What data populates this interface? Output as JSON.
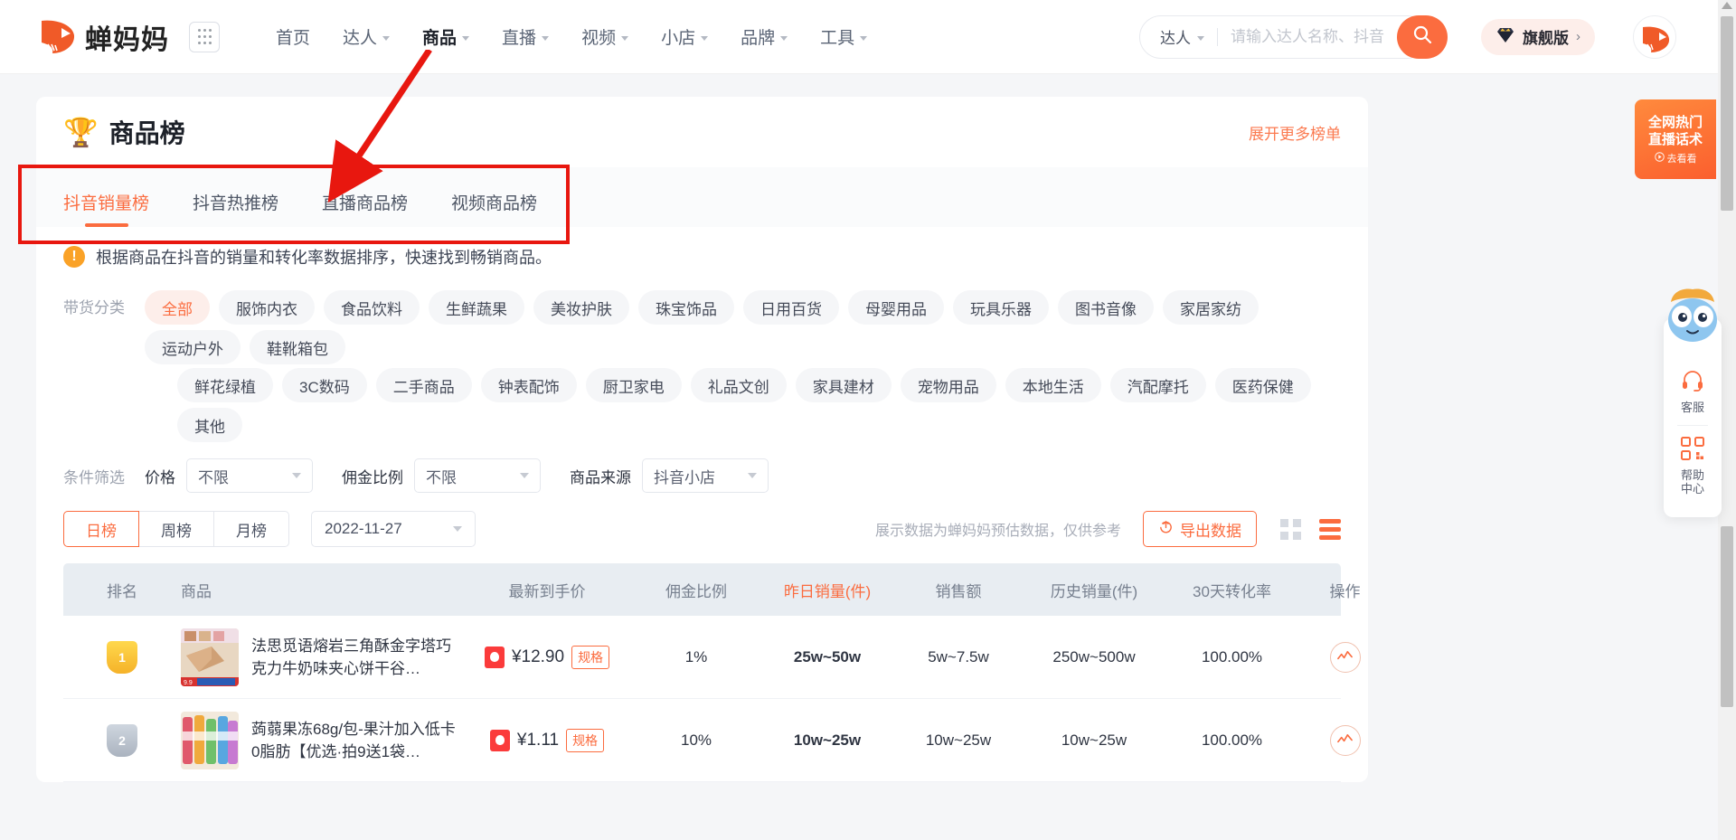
{
  "header": {
    "brand": "蝉妈妈",
    "apps_icon": "grid-apps-icon",
    "nav": [
      {
        "label": "首页",
        "has_caret": false,
        "active": false
      },
      {
        "label": "达人",
        "has_caret": true,
        "active": false
      },
      {
        "label": "商品",
        "has_caret": true,
        "active": true
      },
      {
        "label": "直播",
        "has_caret": true,
        "active": false
      },
      {
        "label": "视频",
        "has_caret": true,
        "active": false
      },
      {
        "label": "小店",
        "has_caret": true,
        "active": false
      },
      {
        "label": "品牌",
        "has_caret": true,
        "active": false
      },
      {
        "label": "工具",
        "has_caret": true,
        "active": false
      }
    ],
    "search": {
      "type_label": "达人",
      "placeholder": "请输入达人名称、抖音号",
      "value": "",
      "button_icon": "search-icon",
      "accent": "#fb6c3f"
    },
    "vip": {
      "label": "旗舰版",
      "arrow": "›",
      "icon": "diamond-crown-icon"
    },
    "avatar_icon": "user-avatar-logo"
  },
  "promo": {
    "line1": "全网热门",
    "line2": "直播话术",
    "cta": "去看看",
    "cta_icon": "play-circle-icon"
  },
  "page": {
    "title": "商品榜",
    "title_icon": "trophy-icon",
    "expand_more": "展开更多榜单",
    "tabs": [
      {
        "label": "抖音销量榜",
        "active": true
      },
      {
        "label": "抖音热推榜",
        "active": false
      },
      {
        "label": "直播商品榜",
        "active": false
      },
      {
        "label": "视频商品榜",
        "active": false
      }
    ],
    "info_text": "根据商品在抖音的销量和转化率数据排序，快速找到畅销商品。",
    "info_icon": "exclamation-circle-icon"
  },
  "category_filter": {
    "label": "带货分类",
    "row1": [
      {
        "label": "全部",
        "active": true
      },
      {
        "label": "服饰内衣",
        "active": false
      },
      {
        "label": "食品饮料",
        "active": false
      },
      {
        "label": "生鲜蔬果",
        "active": false
      },
      {
        "label": "美妆护肤",
        "active": false
      },
      {
        "label": "珠宝饰品",
        "active": false
      },
      {
        "label": "日用百货",
        "active": false
      },
      {
        "label": "母婴用品",
        "active": false
      },
      {
        "label": "玩具乐器",
        "active": false
      },
      {
        "label": "图书音像",
        "active": false
      },
      {
        "label": "家居家纺",
        "active": false
      },
      {
        "label": "运动户外",
        "active": false
      },
      {
        "label": "鞋靴箱包",
        "active": false
      }
    ],
    "row2": [
      {
        "label": "鲜花绿植",
        "active": false
      },
      {
        "label": "3C数码",
        "active": false
      },
      {
        "label": "二手商品",
        "active": false
      },
      {
        "label": "钟表配饰",
        "active": false
      },
      {
        "label": "厨卫家电",
        "active": false
      },
      {
        "label": "礼品文创",
        "active": false
      },
      {
        "label": "家具建材",
        "active": false
      },
      {
        "label": "宠物用品",
        "active": false
      },
      {
        "label": "本地生活",
        "active": false
      },
      {
        "label": "汽配摩托",
        "active": false
      },
      {
        "label": "医药保健",
        "active": false
      },
      {
        "label": "其他",
        "active": false
      }
    ]
  },
  "condition_filter": {
    "label": "条件筛选",
    "price": {
      "label": "价格",
      "value": "不限"
    },
    "commission": {
      "label": "佣金比例",
      "value": "不限"
    },
    "source": {
      "label": "商品来源",
      "value": "抖音小店"
    }
  },
  "period": {
    "segments": [
      {
        "label": "日榜",
        "active": true
      },
      {
        "label": "周榜",
        "active": false
      },
      {
        "label": "月榜",
        "active": false
      }
    ],
    "date": "2022-11-27",
    "note": "展示数据为蝉妈妈预估数据，仅供参考",
    "export_label": "导出数据",
    "export_icon": "upload-icon",
    "view_grid_icon": "grid-view-icon",
    "view_list_icon": "list-view-icon"
  },
  "table": {
    "columns": [
      {
        "label": "排名",
        "highlight": false
      },
      {
        "label": "商品",
        "highlight": false
      },
      {
        "label": "最新到手价",
        "highlight": false
      },
      {
        "label": "佣金比例",
        "highlight": false
      },
      {
        "label": "昨日销量(件)",
        "highlight": true
      },
      {
        "label": "销售额",
        "highlight": false
      },
      {
        "label": "历史销量(件)",
        "highlight": false
      },
      {
        "label": "30天转化率",
        "highlight": false
      },
      {
        "label": "操作",
        "highlight": false
      }
    ],
    "rows": [
      {
        "rank": "1",
        "name": "法思觅语熔岩三角酥金字塔巧克力牛奶味夹心饼干谷…",
        "price": "¥12.90",
        "spec": "规格",
        "commission": "1%",
        "sales_yesterday": "25w~50w",
        "amount": "5w~7.5w",
        "history": "250w~500w",
        "conversion": "100.00%",
        "action_icon": "trend-chart-icon"
      },
      {
        "rank": "2",
        "name": "蒟蒻果冻68g/包-果汁加入低卡0脂肪【优选·拍9送1袋…",
        "price": "¥1.11",
        "spec": "规格",
        "commission": "10%",
        "sales_yesterday": "10w~25w",
        "amount": "10w~25w",
        "history": "10w~25w",
        "conversion": "100.00%",
        "action_icon": "trend-chart-icon"
      }
    ]
  },
  "right_rail": {
    "mascot_icon": "mascot-icon",
    "items": [
      {
        "icon": "headset-icon",
        "label": "客服"
      },
      {
        "icon": "qrcode-icon",
        "label": "帮助\n中心"
      }
    ],
    "item1_label": "客服",
    "item2_label_l1": "帮助",
    "item2_label_l2": "中心"
  },
  "annotations": {
    "box_color": "#e8170f",
    "arrow_color": "#e8170f"
  }
}
